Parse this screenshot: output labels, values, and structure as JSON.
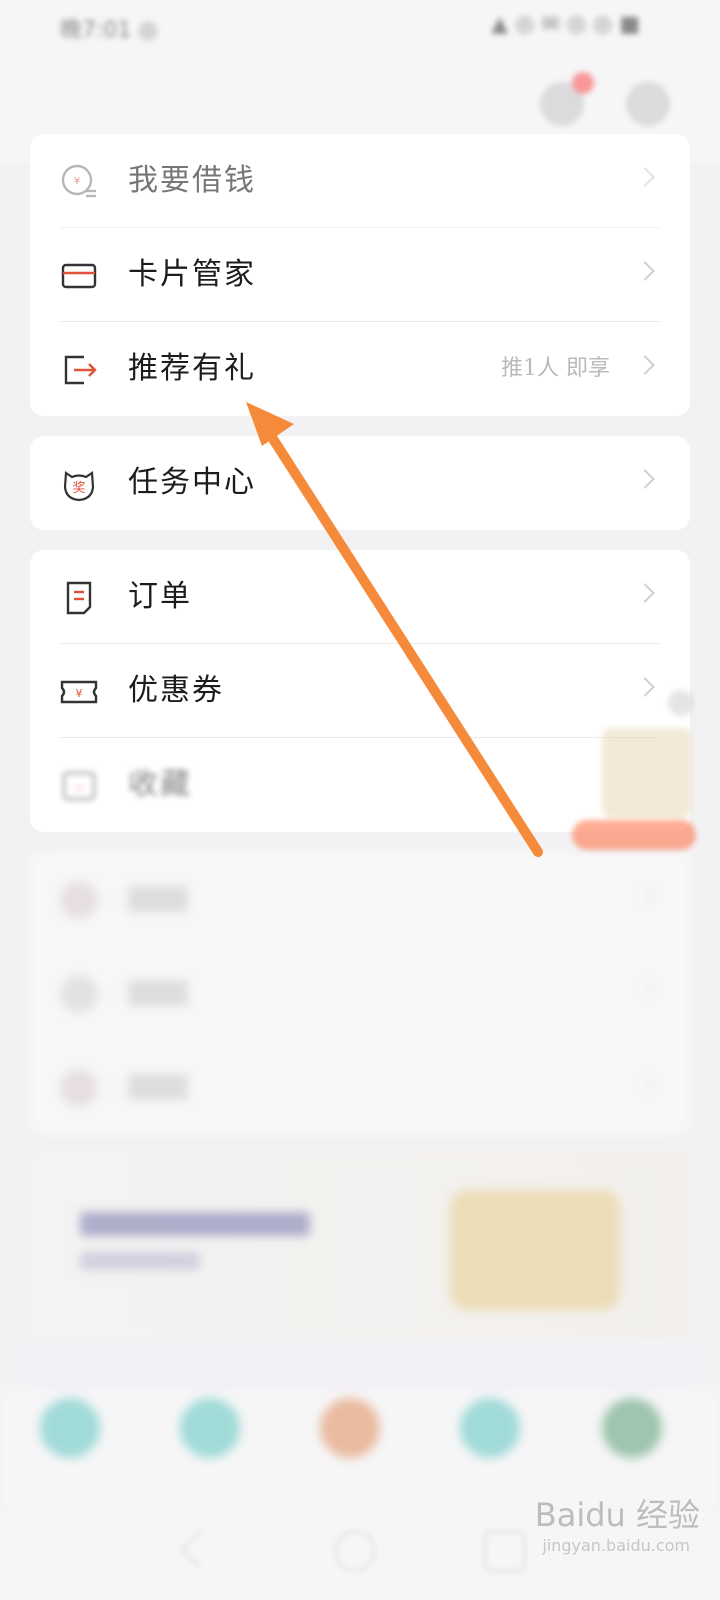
{
  "status": {
    "left": "晚7:01 ◎ ",
    "right": "▲ ◎ ✉ ◎ ◎ ■"
  },
  "header": {
    "badge": ""
  },
  "card1": {
    "items": [
      {
        "label": "我要借钱",
        "hint": ""
      },
      {
        "label": "卡片管家",
        "hint": ""
      },
      {
        "label": "推荐有礼",
        "hint": "推1人 即享"
      }
    ]
  },
  "card2": {
    "items": [
      {
        "label": "任务中心",
        "hint": ""
      }
    ]
  },
  "card3": {
    "items": [
      {
        "label": "订单",
        "hint": ""
      },
      {
        "label": "优惠券",
        "hint": ""
      },
      {
        "label": "收藏",
        "hint": ""
      }
    ]
  },
  "card4": {
    "items": [
      {
        "label": "",
        "hint": ""
      },
      {
        "label": "",
        "hint": ""
      },
      {
        "label": "",
        "hint": ""
      }
    ]
  },
  "tabs": [
    {
      "label": ""
    },
    {
      "label": ""
    },
    {
      "label": ""
    },
    {
      "label": ""
    },
    {
      "label": ""
    }
  ],
  "watermark": {
    "brand": "Baidu 经验",
    "sub": "jingyan.baidu.com"
  },
  "colors": {
    "accent": "#e0523a",
    "arrow": "#f58a3a"
  }
}
